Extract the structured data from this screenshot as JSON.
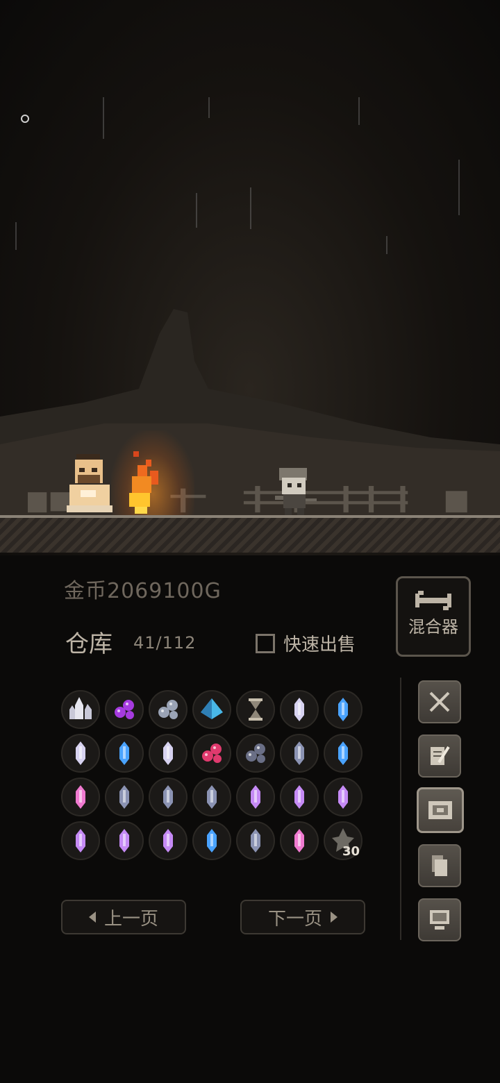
{
  "wallet": {
    "gold_text": "金币2069100G"
  },
  "mixer": {
    "label": "混合器",
    "icon": "wrench-icon"
  },
  "storage": {
    "title": "仓库",
    "count_text": "41/112",
    "quick_sell_label": "快速出售",
    "quick_sell_checked": false
  },
  "inventory": {
    "items": [
      {
        "icon": "white-crystal-cluster",
        "color": "#e6e6ef"
      },
      {
        "icon": "purple-orb-cluster",
        "color": "#a63be0"
      },
      {
        "icon": "dark-orb-cluster",
        "color": "#9aa3b5"
      },
      {
        "icon": "blue-pyramid-crystal",
        "color": "#49b7e8"
      },
      {
        "icon": "hourglass",
        "color": "#c8bfae"
      },
      {
        "icon": "pale-crystal",
        "color": "#d7d2f0"
      },
      {
        "icon": "blue-crystal",
        "color": "#4aa3ff"
      },
      {
        "icon": "pale-crystal",
        "color": "#d7d2f0"
      },
      {
        "icon": "blue-crystal",
        "color": "#4aa3ff"
      },
      {
        "icon": "pale-crystal",
        "color": "#d7d2f0"
      },
      {
        "icon": "red-orb-cluster",
        "color": "#e03a6e"
      },
      {
        "icon": "dark-orb-cluster",
        "color": "#6a6f86"
      },
      {
        "icon": "dark-crystal",
        "color": "#8b93b3"
      },
      {
        "icon": "blue-crystal",
        "color": "#4aa3ff"
      },
      {
        "icon": "pink-crystal",
        "color": "#f07ad0"
      },
      {
        "icon": "dark-crystal",
        "color": "#8b93b3"
      },
      {
        "icon": "dark-crystal",
        "color": "#8b93b3"
      },
      {
        "icon": "dark-crystal",
        "color": "#8b93b3"
      },
      {
        "icon": "violet-crystal",
        "color": "#c58af5"
      },
      {
        "icon": "violet-crystal",
        "color": "#c58af5"
      },
      {
        "icon": "violet-crystal",
        "color": "#c58af5"
      },
      {
        "icon": "violet-crystal",
        "color": "#c58af5"
      },
      {
        "icon": "violet-crystal",
        "color": "#c58af5"
      },
      {
        "icon": "violet-crystal",
        "color": "#c58af5"
      },
      {
        "icon": "blue-crystal",
        "color": "#4aa3ff"
      },
      {
        "icon": "dark-crystal",
        "color": "#8b93b3"
      },
      {
        "icon": "pink-crystal",
        "color": "#f07ad0"
      },
      {
        "icon": "dark-leaf-material",
        "color": "#6d6a63",
        "count": "30"
      }
    ]
  },
  "pagination": {
    "prev_label": "上一页",
    "next_label": "下一页"
  },
  "side_menu": [
    {
      "icon": "crossed-swords-icon",
      "active": false
    },
    {
      "icon": "scroll-quill-icon",
      "active": false
    },
    {
      "icon": "map-icon",
      "active": true
    },
    {
      "icon": "documents-icon",
      "active": false
    },
    {
      "icon": "computer-icon",
      "active": false
    }
  ]
}
